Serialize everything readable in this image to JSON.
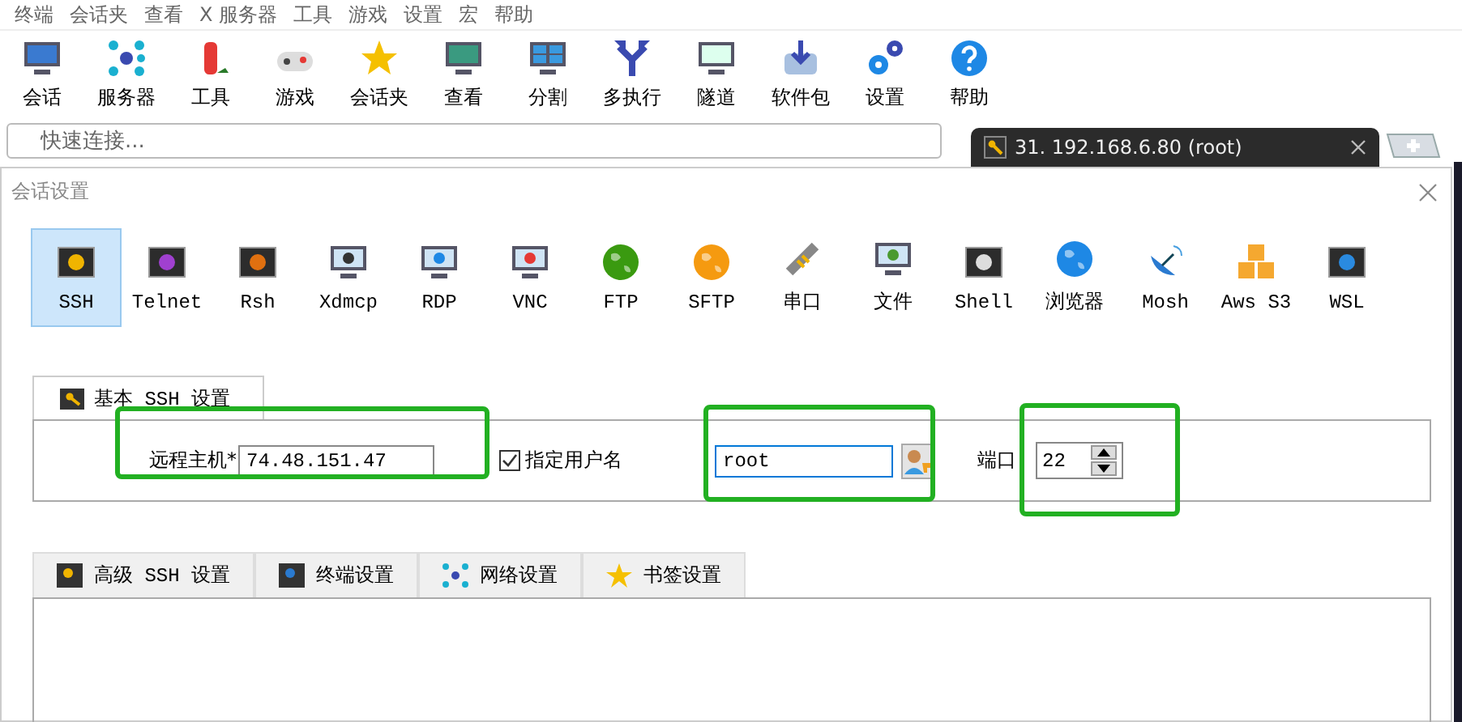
{
  "menu": [
    "终端",
    "会话夹",
    "查看",
    "X 服务器",
    "工具",
    "游戏",
    "设置",
    "宏",
    "帮助"
  ],
  "toolbar": [
    "会话",
    "服务器",
    "工具",
    "游戏",
    "会话夹",
    "查看",
    "分割",
    "多执行",
    "隧道",
    "软件包",
    "设置",
    "帮助"
  ],
  "quick_connect": {
    "placeholder": "快速连接..."
  },
  "session_tab": {
    "label": "31. 192.168.6.80 (root)",
    "selected": true
  },
  "dialog": {
    "title": "会话设置",
    "session_types": [
      {
        "label": "SSH",
        "selected": true
      },
      {
        "label": "Telnet",
        "selected": false
      },
      {
        "label": "Rsh",
        "selected": false
      },
      {
        "label": "Xdmcp",
        "selected": false
      },
      {
        "label": "RDP",
        "selected": false
      },
      {
        "label": "VNC",
        "selected": false
      },
      {
        "label": "FTP",
        "selected": false
      },
      {
        "label": "SFTP",
        "selected": false
      },
      {
        "label": "串口",
        "selected": false
      },
      {
        "label": "文件",
        "selected": false
      },
      {
        "label": "Shell",
        "selected": false
      },
      {
        "label": "浏览器",
        "selected": false
      },
      {
        "label": "Mosh",
        "selected": false
      },
      {
        "label": "Aws S3",
        "selected": false
      },
      {
        "label": "WSL",
        "selected": false
      }
    ],
    "basic_tab": {
      "label": "基本 SSH 设置",
      "selected": true
    },
    "remote_host": {
      "label": "远程主机*",
      "value": "74.48.151.47"
    },
    "specify_username": {
      "label": "指定用户名",
      "checked": true
    },
    "username": {
      "value": "root"
    },
    "port": {
      "label": "端口",
      "value": "22"
    },
    "advanced_tabs": [
      {
        "label": "高级 SSH 设置"
      },
      {
        "label": "终端设置"
      },
      {
        "label": "网络设置"
      },
      {
        "label": "书签设置"
      }
    ]
  }
}
